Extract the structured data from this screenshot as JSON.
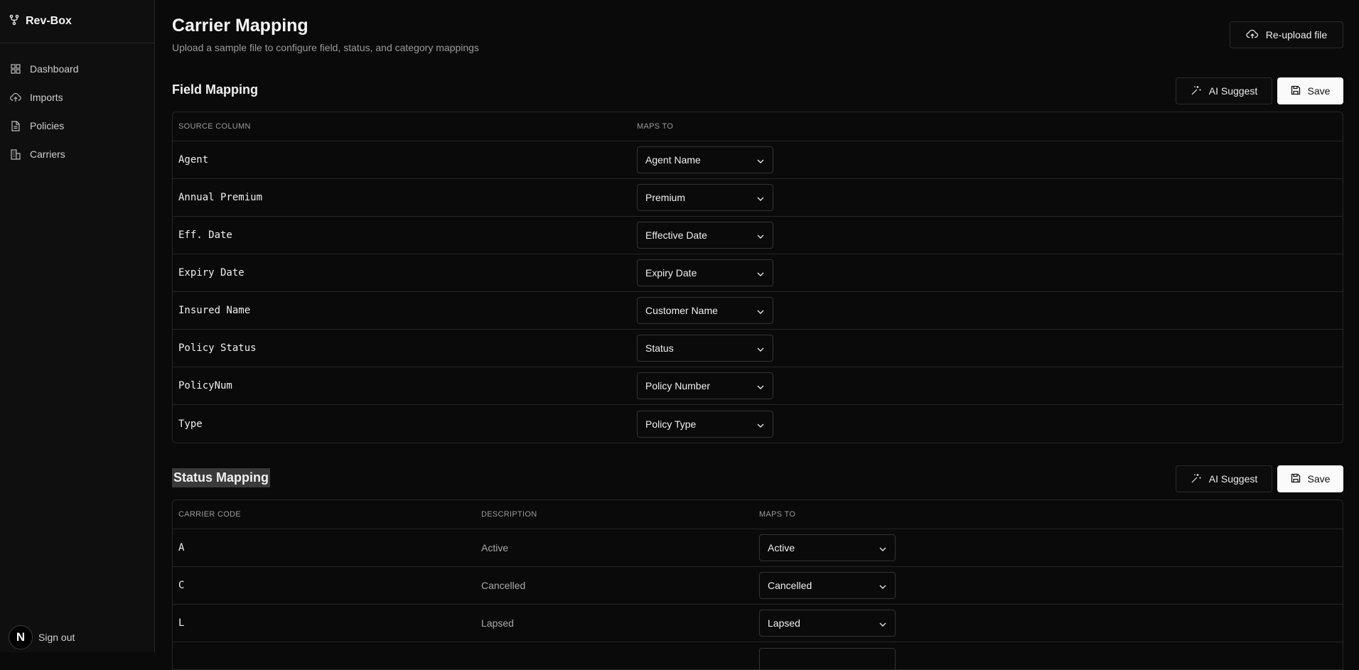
{
  "app": {
    "name": "Rev-Box"
  },
  "sidebar": {
    "items": [
      {
        "label": "Dashboard",
        "icon": "grid-icon"
      },
      {
        "label": "Imports",
        "icon": "cloud-upload-icon"
      },
      {
        "label": "Policies",
        "icon": "document-icon"
      },
      {
        "label": "Carriers",
        "icon": "building-icon"
      }
    ],
    "avatar_letter": "N",
    "signout_label": "Sign out"
  },
  "header": {
    "title": "Carrier Mapping",
    "subtitle": "Upload a sample file to configure field, status, and category mappings",
    "reupload_label": "Re-upload file"
  },
  "field_mapping": {
    "title": "Field Mapping",
    "ai_label": "AI Suggest",
    "save_label": "Save",
    "columns": [
      "SOURCE COLUMN",
      "MAPS TO"
    ],
    "rows": [
      {
        "source": "Agent",
        "maps_to": "Agent Name"
      },
      {
        "source": "Annual Premium",
        "maps_to": "Premium"
      },
      {
        "source": "Eff. Date",
        "maps_to": "Effective Date"
      },
      {
        "source": "Expiry Date",
        "maps_to": "Expiry Date"
      },
      {
        "source": "Insured Name",
        "maps_to": "Customer Name"
      },
      {
        "source": "Policy Status",
        "maps_to": "Status"
      },
      {
        "source": "PolicyNum",
        "maps_to": "Policy Number"
      },
      {
        "source": "Type",
        "maps_to": "Policy Type"
      }
    ]
  },
  "status_mapping": {
    "title": "Status Mapping",
    "ai_label": "AI Suggest",
    "save_label": "Save",
    "columns": [
      "CARRIER CODE",
      "DESCRIPTION",
      "MAPS TO"
    ],
    "rows": [
      {
        "code": "A",
        "description": "Active",
        "maps_to": "Active"
      },
      {
        "code": "C",
        "description": "Cancelled",
        "maps_to": "Cancelled"
      },
      {
        "code": "L",
        "description": "Lapsed",
        "maps_to": "Lapsed"
      }
    ]
  }
}
